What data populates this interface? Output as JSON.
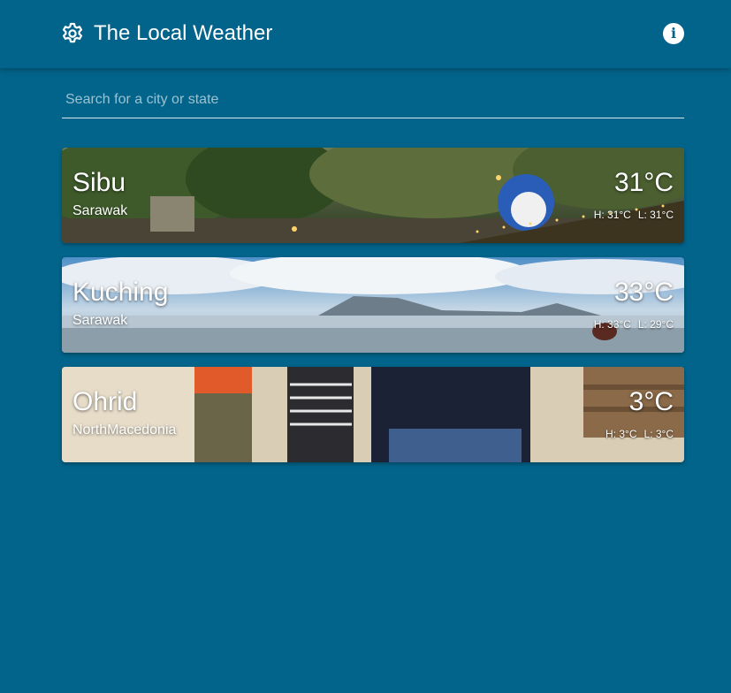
{
  "app": {
    "title": "The Local Weather"
  },
  "search": {
    "placeholder": "Search for a city or state",
    "value": ""
  },
  "cities": [
    {
      "name": "Sibu",
      "region": "Sarawak",
      "temp": "31°C",
      "high": "H: 31°C",
      "low": "L: 31°C"
    },
    {
      "name": "Kuching",
      "region": "Sarawak",
      "temp": "33°C",
      "high": "H: 33°C",
      "low": "L: 29°C"
    },
    {
      "name": "Ohrid",
      "region": "NorthMacedonia",
      "temp": "3°C",
      "high": "H: 3°C",
      "low": "L: 3°C"
    }
  ],
  "colors": {
    "background": "#02648a",
    "accent": "#ffffff"
  },
  "icons": {
    "settings": "gear-icon",
    "info": "info-icon"
  }
}
